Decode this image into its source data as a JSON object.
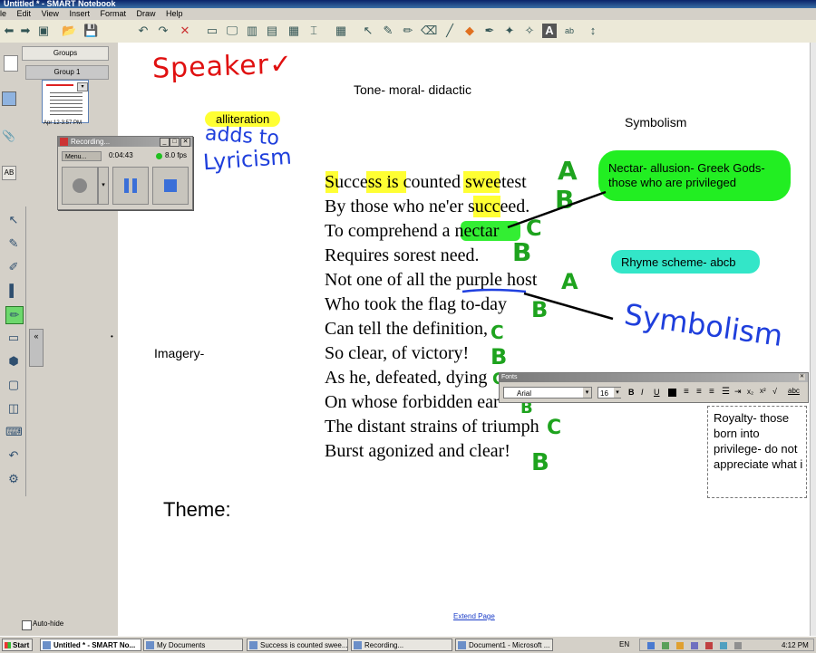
{
  "window": {
    "title": "Untitled * - SMART Notebook"
  },
  "menu": [
    "le",
    "Edit",
    "View",
    "Insert",
    "Format",
    "Draw",
    "Help"
  ],
  "sidebar": {
    "groups_label": "Groups",
    "group_label": "Group 1",
    "thumbnail_caption": "Apr 12-3:57 PM",
    "autohide_label": "Auto-hide"
  },
  "recorder": {
    "title": "Recording...",
    "menu_label": "Menu...",
    "time": "0:04:43",
    "fps": "8.0 fps"
  },
  "page": {
    "handwriting_speaker": "Speaker✓",
    "tone": "Tone- moral- didactic",
    "alliteration": "alliteration",
    "handwriting_adds": "adds to",
    "handwriting_lyricism": "Lyricism",
    "symbolism_heading": "Symbolism",
    "nectar_note": "Nectar- allusion- Greek Gods- those who are privileged",
    "rhyme_scheme": "Rhyme scheme- abcb",
    "imagery": "Imagery-",
    "handwriting_symbolism": "Symbolism",
    "royalty_note": "Royalty- those born into privilege- do not appreciate what i",
    "theme": "Theme:",
    "extend_page": "Extend Page",
    "poem": [
      "Success is counted sweetest",
      "By those who ne'er succeed.",
      "To comprehend a nectar",
      "Requires sorest need.",
      "Not one of all the purple host",
      "Who took the flag to-day",
      "Can tell the definition,",
      "So clear, of victory!",
      "As he, defeated, dying",
      "On whose forbidden ear",
      "The distant strains of triumph",
      "Burst agonized and clear!"
    ],
    "rhyme_marks": [
      "A",
      "B",
      "C",
      "B",
      "A",
      "B",
      "C",
      "B",
      "C",
      "B",
      "C",
      "B"
    ]
  },
  "fonts_toolbar": {
    "title": "Fonts",
    "font": "Arial",
    "size": "16"
  },
  "taskbar": {
    "start": "Start",
    "tasks": [
      "Untitled * - SMART No...",
      "My Documents",
      "Success is counted swee...",
      "Recording...",
      "Document1 - Microsoft ..."
    ],
    "lang": "EN",
    "clock": "4:12 PM"
  }
}
